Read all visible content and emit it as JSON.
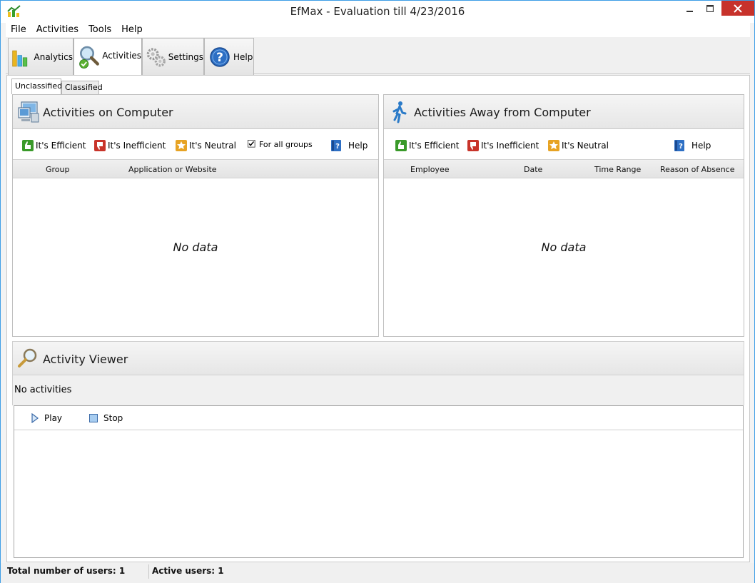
{
  "window": {
    "title": "EfMax - Evaluation till 4/23/2016"
  },
  "menu": [
    "File",
    "Activities",
    "Tools",
    "Help"
  ],
  "toolbar": {
    "tabs": [
      {
        "label": "Analytics",
        "icon": "bar-chart-icon"
      },
      {
        "label": "Activities",
        "icon": "magnifier-check-icon",
        "active": true
      },
      {
        "label": "Settings",
        "icon": "gears-icon"
      },
      {
        "label": "Help",
        "icon": "help-circle-icon"
      }
    ]
  },
  "subtabs": [
    {
      "label": "Unclassified",
      "active": true
    },
    {
      "label": "Classified"
    }
  ],
  "computer_panel": {
    "title": "Activities on Computer",
    "efficient": "It's Efficient",
    "inefficient": "It's Inefficient",
    "neutral": "It's Neutral",
    "for_all_groups": "For all groups",
    "for_all_groups_checked": true,
    "help": "Help",
    "columns": [
      "Group",
      "Application or Website"
    ],
    "empty": "No data"
  },
  "away_panel": {
    "title": "Activities Away from Computer",
    "efficient": "It's Efficient",
    "inefficient": "It's Inefficient",
    "neutral": "It's Neutral",
    "help": "Help",
    "columns": [
      "Employee",
      "Date",
      "Time Range",
      "Reason of Absence"
    ],
    "empty": "No data"
  },
  "viewer": {
    "title": "Activity Viewer",
    "status": "No activities",
    "play": "Play",
    "stop": "Stop"
  },
  "statusbar": {
    "total_users": "Total number of users: 1",
    "active_users": "Active users: 1"
  },
  "colors": {
    "efficient": "#3a9a2a",
    "inefficient": "#c8342a",
    "neutral": "#e7a323",
    "help": "#2d6fc4",
    "close": "#c7322b"
  }
}
